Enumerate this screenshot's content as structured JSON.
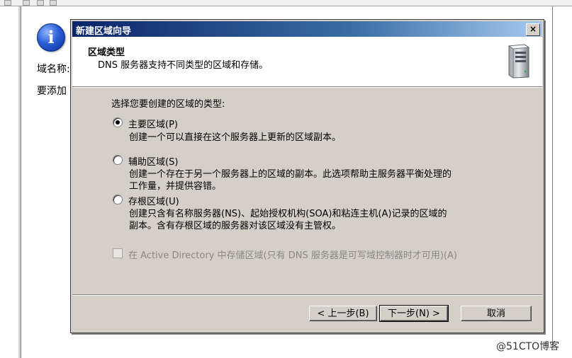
{
  "background_window": {
    "domain_label": "域名称:",
    "add_label": "要添加",
    "icon": "info-icon"
  },
  "dialog": {
    "title": "新建区域向导",
    "close_glyph": "×",
    "header": {
      "title": "区域类型",
      "subtitle": "DNS 服务器支持不同类型的区域和存储。",
      "icon": "server-icon"
    },
    "prompt": "选择您要创建的区域的类型:",
    "options": [
      {
        "label": "主要区域(P)",
        "selected": true,
        "desc_lines": [
          "创建一个可以直接在这个服务器上更新的区域副本。"
        ]
      },
      {
        "label": "辅助区域(S)",
        "selected": false,
        "desc_lines": [
          "创建一个存在于另一个服务器上的区域的副本。此选项帮助主服务器平衡处理的",
          "工作量，并提供容错。"
        ]
      },
      {
        "label": "存根区域(U)",
        "selected": false,
        "desc_lines": [
          "创建只含有名称服务器(NS)、起始授权机构(SOA)和粘连主机(A)记录的区域的",
          "副本。含有存根区域的服务器对该区域没有主管权。"
        ]
      }
    ],
    "ad_checkbox": {
      "label": "在 Active Directory 中存储区域(只有 DNS 服务器是可写域控制器时才可用)(A)",
      "checked": false,
      "enabled": false
    },
    "buttons": {
      "back": "< 上一步(B)",
      "next": "下一步(N) >",
      "cancel": "取消"
    }
  },
  "watermark": "@51CTO博客",
  "colors": {
    "dialog_face": "#d4d0c8",
    "title_start": "#0a246a",
    "title_end": "#a6caf0",
    "disabled_text": "#8a8782"
  }
}
